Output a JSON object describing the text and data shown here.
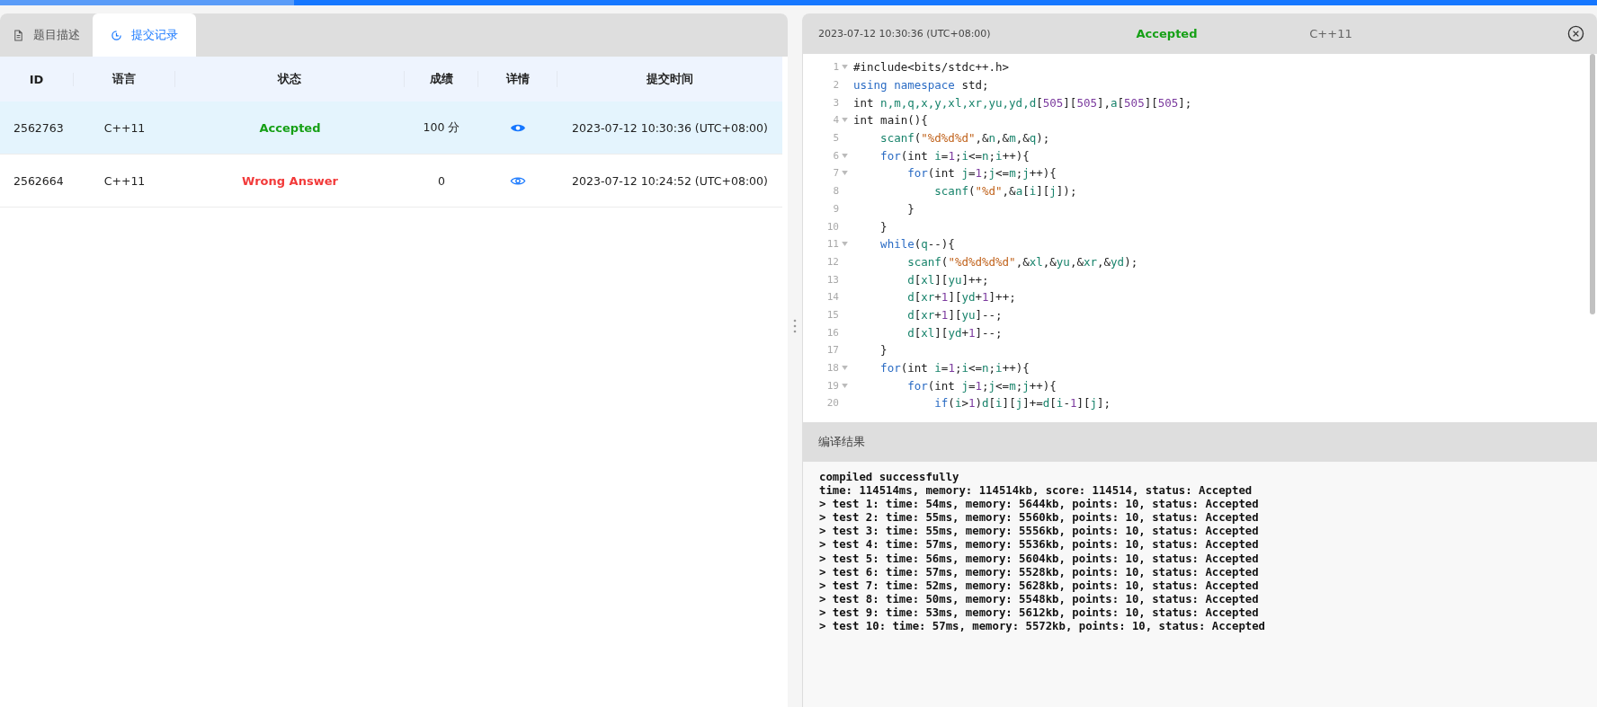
{
  "loading_bar": {
    "level": 0.184
  },
  "left_panel": {
    "tabs": [
      {
        "label": "题目描述",
        "selected": false
      },
      {
        "label": "提交记录",
        "selected": true
      }
    ],
    "table": {
      "columns": [
        "ID",
        "语言",
        "状态",
        "成绩",
        "详情",
        "提交时间"
      ],
      "rows": [
        {
          "id": "2562763",
          "language": "C++11",
          "status": "Accepted",
          "kind": "accepted",
          "score": "100 分",
          "time": "2023-07-12 10:30:36 (UTC+08:00)",
          "selected": true
        },
        {
          "id": "2562664",
          "language": "C++11",
          "status": "Wrong Answer",
          "kind": "wrong",
          "score": "0",
          "time": "2023-07-12 10:24:52 (UTC+08:00)",
          "selected": false
        }
      ]
    }
  },
  "right_panel": {
    "header": {
      "time": "2023-07-12 10:30:36 (UTC+08:00)",
      "status": "Accepted",
      "kind": "accepted",
      "language": "C++11"
    },
    "code": [
      {
        "number": "1",
        "foldable": true,
        "tokens": [
          {
            "kind": "plain",
            "text": "#include<bits/stdc++.h>"
          }
        ]
      },
      {
        "number": "2",
        "foldable": false,
        "tokens": [
          {
            "kind": "keyword",
            "text": "using namespace"
          },
          {
            "kind": "plain",
            "text": " std;"
          }
        ]
      },
      {
        "number": "3",
        "foldable": false,
        "tokens": [
          {
            "kind": "plain",
            "text": "int "
          },
          {
            "kind": "name",
            "text": "n,m,q,x,y,xl,xr,yu,yd,d"
          },
          {
            "kind": "plain",
            "text": "["
          },
          {
            "kind": "number",
            "text": "505"
          },
          {
            "kind": "plain",
            "text": "]["
          },
          {
            "kind": "number",
            "text": "505"
          },
          {
            "kind": "plain",
            "text": "],"
          },
          {
            "kind": "name",
            "text": "a"
          },
          {
            "kind": "plain",
            "text": "["
          },
          {
            "kind": "number",
            "text": "505"
          },
          {
            "kind": "plain",
            "text": "]["
          },
          {
            "kind": "number",
            "text": "505"
          },
          {
            "kind": "plain",
            "text": "];"
          }
        ]
      },
      {
        "number": "4",
        "foldable": true,
        "tokens": [
          {
            "kind": "plain",
            "text": "int main(){"
          }
        ]
      },
      {
        "number": "5",
        "foldable": false,
        "tokens": [
          {
            "kind": "name",
            "text": "    scanf"
          },
          {
            "kind": "plain",
            "text": "("
          },
          {
            "kind": "string",
            "text": "\"%d%d%d\""
          },
          {
            "kind": "plain",
            "text": ",&"
          },
          {
            "kind": "name",
            "text": "n"
          },
          {
            "kind": "plain",
            "text": ",&"
          },
          {
            "kind": "name",
            "text": "m"
          },
          {
            "kind": "plain",
            "text": ",&"
          },
          {
            "kind": "name",
            "text": "q"
          },
          {
            "kind": "plain",
            "text": ");"
          }
        ]
      },
      {
        "number": "6",
        "foldable": true,
        "tokens": [
          {
            "kind": "keyword",
            "text": "    for"
          },
          {
            "kind": "plain",
            "text": "(int "
          },
          {
            "kind": "name",
            "text": "i"
          },
          {
            "kind": "plain",
            "text": "="
          },
          {
            "kind": "number",
            "text": "1"
          },
          {
            "kind": "plain",
            "text": ";"
          },
          {
            "kind": "name",
            "text": "i"
          },
          {
            "kind": "plain",
            "text": "<="
          },
          {
            "kind": "name",
            "text": "n"
          },
          {
            "kind": "plain",
            "text": ";"
          },
          {
            "kind": "name",
            "text": "i"
          },
          {
            "kind": "plain",
            "text": "++){"
          }
        ]
      },
      {
        "number": "7",
        "foldable": true,
        "tokens": [
          {
            "kind": "keyword",
            "text": "        for"
          },
          {
            "kind": "plain",
            "text": "(int "
          },
          {
            "kind": "name",
            "text": "j"
          },
          {
            "kind": "plain",
            "text": "="
          },
          {
            "kind": "number",
            "text": "1"
          },
          {
            "kind": "plain",
            "text": ";"
          },
          {
            "kind": "name",
            "text": "j"
          },
          {
            "kind": "plain",
            "text": "<="
          },
          {
            "kind": "name",
            "text": "m"
          },
          {
            "kind": "plain",
            "text": ";"
          },
          {
            "kind": "name",
            "text": "j"
          },
          {
            "kind": "plain",
            "text": "++){"
          }
        ]
      },
      {
        "number": "8",
        "foldable": false,
        "tokens": [
          {
            "kind": "name",
            "text": "            scanf"
          },
          {
            "kind": "plain",
            "text": "("
          },
          {
            "kind": "string",
            "text": "\"%d\""
          },
          {
            "kind": "plain",
            "text": ",&"
          },
          {
            "kind": "name",
            "text": "a"
          },
          {
            "kind": "plain",
            "text": "["
          },
          {
            "kind": "name",
            "text": "i"
          },
          {
            "kind": "plain",
            "text": "]["
          },
          {
            "kind": "name",
            "text": "j"
          },
          {
            "kind": "plain",
            "text": "]);"
          }
        ]
      },
      {
        "number": "9",
        "foldable": false,
        "tokens": [
          {
            "kind": "plain",
            "text": "        }"
          }
        ]
      },
      {
        "number": "10",
        "foldable": false,
        "tokens": [
          {
            "kind": "plain",
            "text": "    }"
          }
        ]
      },
      {
        "number": "11",
        "foldable": true,
        "tokens": [
          {
            "kind": "keyword",
            "text": "    while"
          },
          {
            "kind": "plain",
            "text": "("
          },
          {
            "kind": "name",
            "text": "q"
          },
          {
            "kind": "plain",
            "text": "--){"
          }
        ]
      },
      {
        "number": "12",
        "foldable": false,
        "tokens": [
          {
            "kind": "name",
            "text": "        scanf"
          },
          {
            "kind": "plain",
            "text": "("
          },
          {
            "kind": "string",
            "text": "\"%d%d%d%d\""
          },
          {
            "kind": "plain",
            "text": ",&"
          },
          {
            "kind": "name",
            "text": "xl"
          },
          {
            "kind": "plain",
            "text": ",&"
          },
          {
            "kind": "name",
            "text": "yu"
          },
          {
            "kind": "plain",
            "text": ",&"
          },
          {
            "kind": "name",
            "text": "xr"
          },
          {
            "kind": "plain",
            "text": ",&"
          },
          {
            "kind": "name",
            "text": "yd"
          },
          {
            "kind": "plain",
            "text": ");"
          }
        ]
      },
      {
        "number": "13",
        "foldable": false,
        "tokens": [
          {
            "kind": "name",
            "text": "        d"
          },
          {
            "kind": "plain",
            "text": "["
          },
          {
            "kind": "name",
            "text": "xl"
          },
          {
            "kind": "plain",
            "text": "]["
          },
          {
            "kind": "name",
            "text": "yu"
          },
          {
            "kind": "plain",
            "text": "]++;"
          }
        ]
      },
      {
        "number": "14",
        "foldable": false,
        "tokens": [
          {
            "kind": "name",
            "text": "        d"
          },
          {
            "kind": "plain",
            "text": "["
          },
          {
            "kind": "name",
            "text": "xr"
          },
          {
            "kind": "plain",
            "text": "+"
          },
          {
            "kind": "number",
            "text": "1"
          },
          {
            "kind": "plain",
            "text": "]["
          },
          {
            "kind": "name",
            "text": "yd"
          },
          {
            "kind": "plain",
            "text": "+"
          },
          {
            "kind": "number",
            "text": "1"
          },
          {
            "kind": "plain",
            "text": "]++;"
          }
        ]
      },
      {
        "number": "15",
        "foldable": false,
        "tokens": [
          {
            "kind": "name",
            "text": "        d"
          },
          {
            "kind": "plain",
            "text": "["
          },
          {
            "kind": "name",
            "text": "xr"
          },
          {
            "kind": "plain",
            "text": "+"
          },
          {
            "kind": "number",
            "text": "1"
          },
          {
            "kind": "plain",
            "text": "]["
          },
          {
            "kind": "name",
            "text": "yu"
          },
          {
            "kind": "plain",
            "text": "]--;"
          }
        ]
      },
      {
        "number": "16",
        "foldable": false,
        "tokens": [
          {
            "kind": "name",
            "text": "        d"
          },
          {
            "kind": "plain",
            "text": "["
          },
          {
            "kind": "name",
            "text": "xl"
          },
          {
            "kind": "plain",
            "text": "]["
          },
          {
            "kind": "name",
            "text": "yd"
          },
          {
            "kind": "plain",
            "text": "+"
          },
          {
            "kind": "number",
            "text": "1"
          },
          {
            "kind": "plain",
            "text": "]--;"
          }
        ]
      },
      {
        "number": "17",
        "foldable": false,
        "tokens": [
          {
            "kind": "plain",
            "text": "    }"
          }
        ]
      },
      {
        "number": "18",
        "foldable": true,
        "tokens": [
          {
            "kind": "keyword",
            "text": "    for"
          },
          {
            "kind": "plain",
            "text": "(int "
          },
          {
            "kind": "name",
            "text": "i"
          },
          {
            "kind": "plain",
            "text": "="
          },
          {
            "kind": "number",
            "text": "1"
          },
          {
            "kind": "plain",
            "text": ";"
          },
          {
            "kind": "name",
            "text": "i"
          },
          {
            "kind": "plain",
            "text": "<="
          },
          {
            "kind": "name",
            "text": "n"
          },
          {
            "kind": "plain",
            "text": ";"
          },
          {
            "kind": "name",
            "text": "i"
          },
          {
            "kind": "plain",
            "text": "++){"
          }
        ]
      },
      {
        "number": "19",
        "foldable": true,
        "tokens": [
          {
            "kind": "keyword",
            "text": "        for"
          },
          {
            "kind": "plain",
            "text": "(int "
          },
          {
            "kind": "name",
            "text": "j"
          },
          {
            "kind": "plain",
            "text": "="
          },
          {
            "kind": "number",
            "text": "1"
          },
          {
            "kind": "plain",
            "text": ";"
          },
          {
            "kind": "name",
            "text": "j"
          },
          {
            "kind": "plain",
            "text": "<="
          },
          {
            "kind": "name",
            "text": "m"
          },
          {
            "kind": "plain",
            "text": ";"
          },
          {
            "kind": "name",
            "text": "j"
          },
          {
            "kind": "plain",
            "text": "++){"
          }
        ]
      },
      {
        "number": "20",
        "foldable": false,
        "tokens": [
          {
            "kind": "keyword",
            "text": "            if"
          },
          {
            "kind": "plain",
            "text": "("
          },
          {
            "kind": "name",
            "text": "i"
          },
          {
            "kind": "plain",
            "text": ">"
          },
          {
            "kind": "number",
            "text": "1"
          },
          {
            "kind": "plain",
            "text": ")"
          },
          {
            "kind": "name",
            "text": "d"
          },
          {
            "kind": "plain",
            "text": "["
          },
          {
            "kind": "name",
            "text": "i"
          },
          {
            "kind": "plain",
            "text": "]["
          },
          {
            "kind": "name",
            "text": "j"
          },
          {
            "kind": "plain",
            "text": "]+="
          },
          {
            "kind": "name",
            "text": "d"
          },
          {
            "kind": "plain",
            "text": "["
          },
          {
            "kind": "name",
            "text": "i"
          },
          {
            "kind": "plain",
            "text": "-"
          },
          {
            "kind": "number",
            "text": "1"
          },
          {
            "kind": "plain",
            "text": "]["
          },
          {
            "kind": "name",
            "text": "j"
          },
          {
            "kind": "plain",
            "text": "];"
          }
        ]
      }
    ],
    "compile": {
      "title": "编译结果",
      "output": [
        "compiled successfully",
        "time: 114514ms, memory: 114514kb, score: 114514, status: Accepted",
        "> test 1: time: 54ms, memory: 5644kb, points: 10, status: Accepted",
        "> test 2: time: 55ms, memory: 5560kb, points: 10, status: Accepted",
        "> test 3: time: 55ms, memory: 5556kb, points: 10, status: Accepted",
        "> test 4: time: 57ms, memory: 5536kb, points: 10, status: Accepted",
        "> test 5: time: 56ms, memory: 5604kb, points: 10, status: Accepted",
        "> test 6: time: 57ms, memory: 5528kb, points: 10, status: Accepted",
        "> test 7: time: 52ms, memory: 5628kb, points: 10, status: Accepted",
        "> test 8: time: 50ms, memory: 5548kb, points: 10, status: Accepted",
        "> test 9: time: 53ms, memory: 5612kb, points: 10, status: Accepted",
        "> test 10: time: 57ms, memory: 5572kb, points: 10, status: Accepted"
      ]
    }
  }
}
